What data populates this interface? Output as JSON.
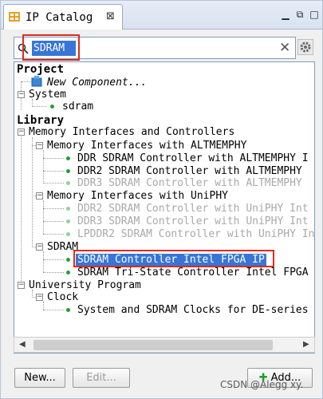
{
  "tab": {
    "title": "IP Catalog",
    "close_glyph": "⊠"
  },
  "search": {
    "value": "SDRAM"
  },
  "tree": {
    "project_header": "Project",
    "new_component": "New Component...",
    "system": "System",
    "sdram_instance": "sdram",
    "library_header": "Library",
    "memory_interfaces": "Memory Interfaces and Controllers",
    "altmemphy_group": "Memory Interfaces with ALTMEMPHY",
    "ddr_altmemphy": "DDR SDRAM Controller with ALTMEMPHY I",
    "ddr2_altmemphy": "DDR2 SDRAM Controller with ALTMEMPHY",
    "ddr3_altmemphy": "DDR3 SDRAM Controller with ALTMEMPHY",
    "uniphy_group": "Memory Interfaces with UniPHY",
    "ddr2_uniphy": "DDR2 SDRAM Controller with UniPHY Int",
    "ddr3_uniphy": "DDR3 SDRAM Controller with UniPHY Int",
    "lpddr2_uniphy": "LPDDR2 SDRAM Controller with UniPHY In",
    "sdram_group": "SDRAM",
    "sdram_controller": "SDRAM Controller Intel FPGA IP",
    "sdram_tristate": "SDRAM Tri-State Controller Intel FPGA",
    "university_program": "University Program",
    "clock_group": "Clock",
    "system_clocks": "System and SDRAM Clocks for DE-series"
  },
  "buttons": {
    "new": "New...",
    "edit": "Edit...",
    "add": "Add..."
  },
  "watermark": "CSDN @Alegg xy.",
  "colors": {
    "selection": "#3875d7",
    "highlight_box": "#e02a1a",
    "bullet": "#21a03a"
  },
  "icons": [
    "catalog-icon",
    "search-icon",
    "clear-icon",
    "settings-icon",
    "component-icon",
    "plus-icon"
  ]
}
